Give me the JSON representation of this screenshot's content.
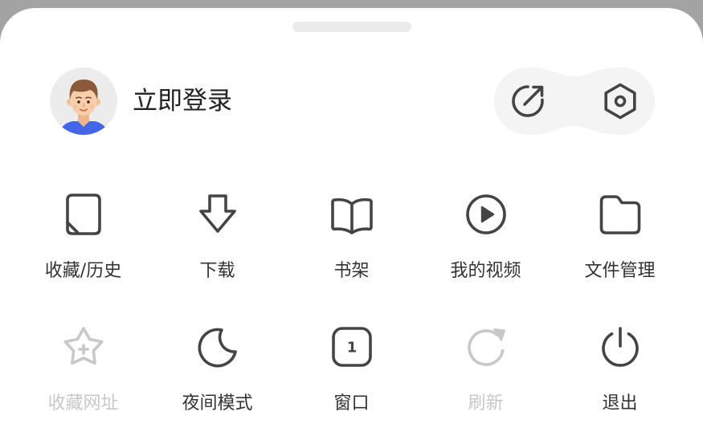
{
  "theme": {
    "overlay_color": "#a3a3a3",
    "sheet_color": "#ffffff",
    "handle_color": "#ebebeb",
    "pill_color": "#f4f4f4",
    "icon_color": "#444444",
    "title_color": "#222222",
    "text_color": "#333333",
    "disabled_color": "#c8c8c8"
  },
  "account": {
    "avatar_icon": "avatar-icon",
    "login_label": "立即登录"
  },
  "header_actions": [
    {
      "icon": "share-icon"
    },
    {
      "icon": "settings-icon"
    }
  ],
  "menu": {
    "items": [
      {
        "label": "收藏/历史",
        "icon": "bookmark-icon",
        "enabled": true
      },
      {
        "label": "下载",
        "icon": "download-icon",
        "enabled": true
      },
      {
        "label": "书架",
        "icon": "bookshelf-icon",
        "enabled": true
      },
      {
        "label": "我的视频",
        "icon": "play-circle-icon",
        "enabled": true
      },
      {
        "label": "文件管理",
        "icon": "folder-icon",
        "enabled": true
      },
      {
        "label": "收藏网址",
        "icon": "star-plus-icon",
        "enabled": false
      },
      {
        "label": "夜间模式",
        "icon": "moon-icon",
        "enabled": true
      },
      {
        "label": "窗口",
        "icon": "window-icon",
        "badge": "1",
        "enabled": true
      },
      {
        "label": "刷新",
        "icon": "refresh-icon",
        "enabled": false
      },
      {
        "label": "退出",
        "icon": "power-icon",
        "enabled": true
      }
    ]
  }
}
